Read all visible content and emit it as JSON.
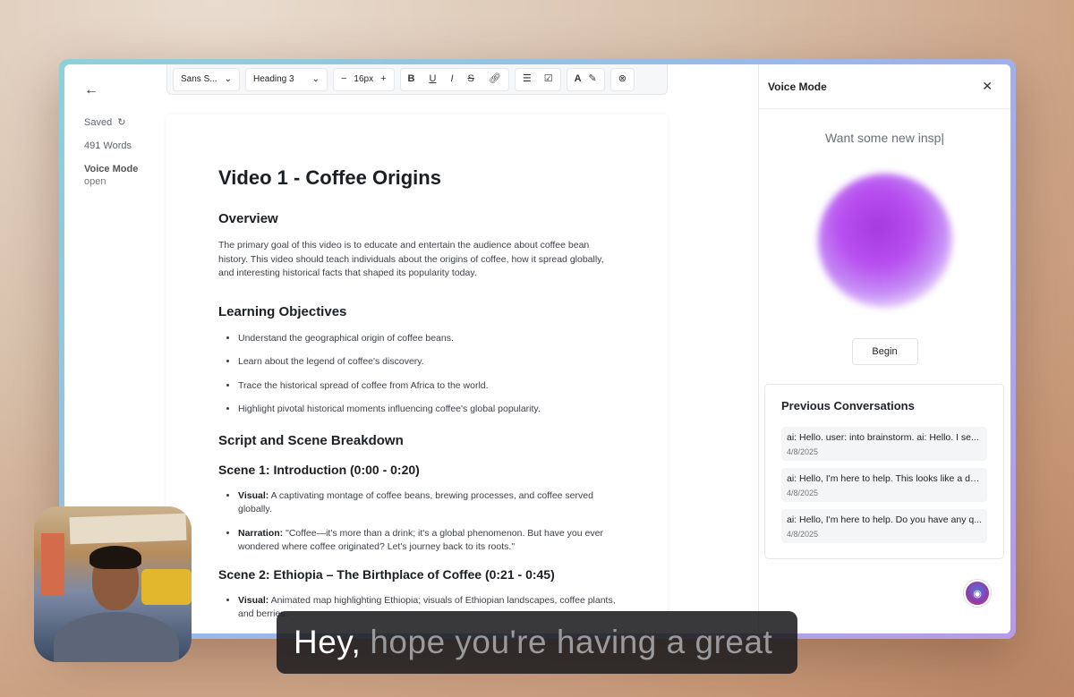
{
  "meta": {
    "saved_label": "Saved",
    "word_count": "491 Words",
    "voice_mode_label": "Voice Mode",
    "voice_mode_state": "open"
  },
  "toolbar": {
    "font_family": "Sans S...",
    "heading_style": "Heading 3",
    "font_size": "16px"
  },
  "document": {
    "title": "Video 1 - Coffee Origins",
    "overview_heading": "Overview",
    "overview_text": "The primary goal of this video is to educate and entertain the audience about coffee bean history. This video should teach individuals about the origins of coffee, how it spread globally, and interesting historical facts that shaped its popularity today.",
    "objectives_heading": "Learning Objectives",
    "objectives": [
      "Understand the geographical origin of coffee beans.",
      "Learn about the legend of coffee's discovery.",
      "Trace the historical spread of coffee from Africa to the world.",
      "Highlight pivotal historical moments influencing coffee's global popularity."
    ],
    "script_heading": "Script and Scene Breakdown",
    "scene1_heading": "Scene 1: Introduction (0:00 - 0:20)",
    "scene1_visual_label": "Visual:",
    "scene1_visual_text": " A captivating montage of coffee beans, brewing processes, and coffee served globally.",
    "scene1_narration_label": "Narration:",
    "scene1_narration_text": " \"Coffee—it's more than a drink; it's a global phenomenon. But have you ever wondered where coffee originated? Let's journey back to its roots.\"",
    "scene2_heading": "Scene 2: Ethiopia – The Birthplace of Coffee (0:21 - 0:45)",
    "scene2_visual_label": "Visual:",
    "scene2_visual_text": " Animated map highlighting Ethiopia; visuals of Ethiopian landscapes, coffee plants, and berries."
  },
  "voice_panel": {
    "title": "Voice Mode",
    "prompt_text": "Want some new insp|",
    "begin_label": "Begin",
    "previous_heading": "Previous Conversations",
    "conversations": [
      {
        "text": "ai: Hello. user: into brainstorm. ai: Hello. I se...",
        "date": "4/8/2025"
      },
      {
        "text": "ai: Hello, I'm here to help. This looks like a de...",
        "date": "4/8/2025"
      },
      {
        "text": "ai: Hello, I'm here to help. Do you have any q...",
        "date": "4/8/2025"
      }
    ]
  },
  "caption": {
    "spoken": "Hey,",
    "pending": "hope you're having a great"
  },
  "colors": {
    "orb": "#b84ff0",
    "window_border": "#9bb7e8"
  }
}
